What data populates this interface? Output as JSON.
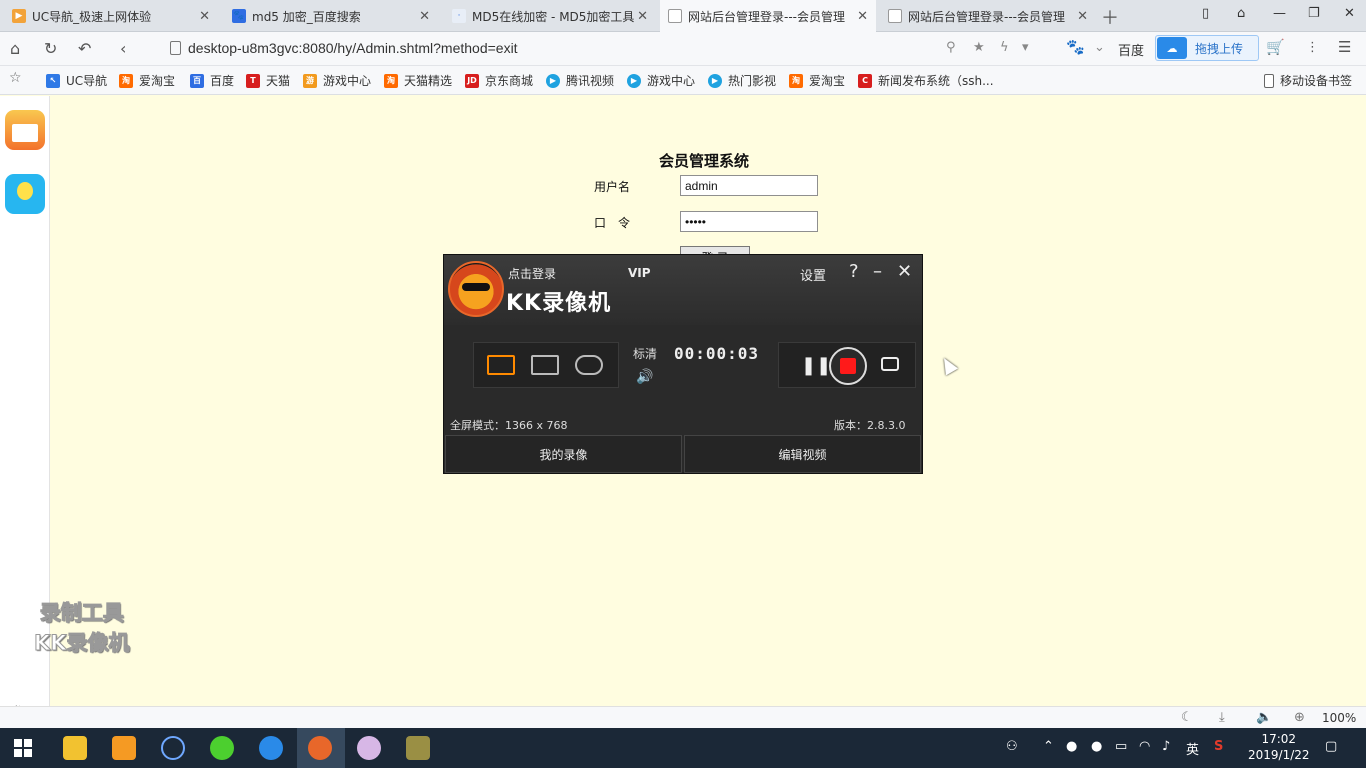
{
  "browser": {
    "tabs": [
      {
        "title": "UC导航_极速上网体验",
        "favicon_color": "#f2a33a"
      },
      {
        "title": "md5 加密_百度搜索",
        "favicon_color": "#2f6de2"
      },
      {
        "title": "MD5在线加密 - MD5加密工具",
        "favicon_color": "#ffffff"
      },
      {
        "title": "网站后台管理登录---会员管理",
        "favicon_color": "#cfd3d8"
      },
      {
        "title": "网站后台管理登录---会员管理",
        "favicon_color": "#cfd3d8"
      }
    ],
    "active_tab": 3,
    "url": "desktop-u8m3gvc:8080/hy/Admin.shtml?method=exit",
    "search_engine": "百度",
    "upload_label": "拖拽上传",
    "bookmarks": [
      {
        "label": "UC导航",
        "color": "#2f79e6",
        "mark": "↖"
      },
      {
        "label": "爱淘宝",
        "color": "#ff6a00",
        "mark": "淘"
      },
      {
        "label": "百度",
        "color": "#2f6de2",
        "mark": "百"
      },
      {
        "label": "天猫",
        "color": "#d71e1e",
        "mark": "T"
      },
      {
        "label": "游戏中心",
        "color": "#f29a1e",
        "mark": "游"
      },
      {
        "label": "天猫精选",
        "color": "#ff6a00",
        "mark": "淘"
      },
      {
        "label": "京东商城",
        "color": "#d71e1e",
        "mark": "JD"
      },
      {
        "label": "腾讯视频",
        "color": "#1fa2e0",
        "mark": "▶"
      },
      {
        "label": "游戏中心",
        "color": "#1fa2e0",
        "mark": "▶"
      },
      {
        "label": "热门影视",
        "color": "#1fa2e0",
        "mark": "▶"
      },
      {
        "label": "爱淘宝",
        "color": "#ff6a00",
        "mark": "淘"
      },
      {
        "label": "新闻发布系统（ssh...",
        "color": "#d71e1e",
        "mark": "C"
      }
    ],
    "mobile_bookmarks": "移动设备书签",
    "zoom": "100%"
  },
  "page": {
    "title": "会员管理系统",
    "username_label": "用户名",
    "username_value": "admin",
    "password_label": "口　令",
    "password_value": "•••••",
    "login_label": "登 录"
  },
  "recorder": {
    "login_link": "点击登录",
    "vip": "VIP",
    "brand": "KK录像机",
    "settings": "设置",
    "help_icon": "?",
    "quality": "标清",
    "timer": "00:00:03",
    "mode_info": "全屏模式：1366 x 768",
    "version": "版本：2.8.3.0",
    "my_videos": "我的录像",
    "edit_video": "编辑视频"
  },
  "watermark": {
    "line1": "录制工具",
    "line2": "KK录像机"
  },
  "taskbar": {
    "ime": "英",
    "time": "17:02",
    "date": "2019/1/22"
  }
}
